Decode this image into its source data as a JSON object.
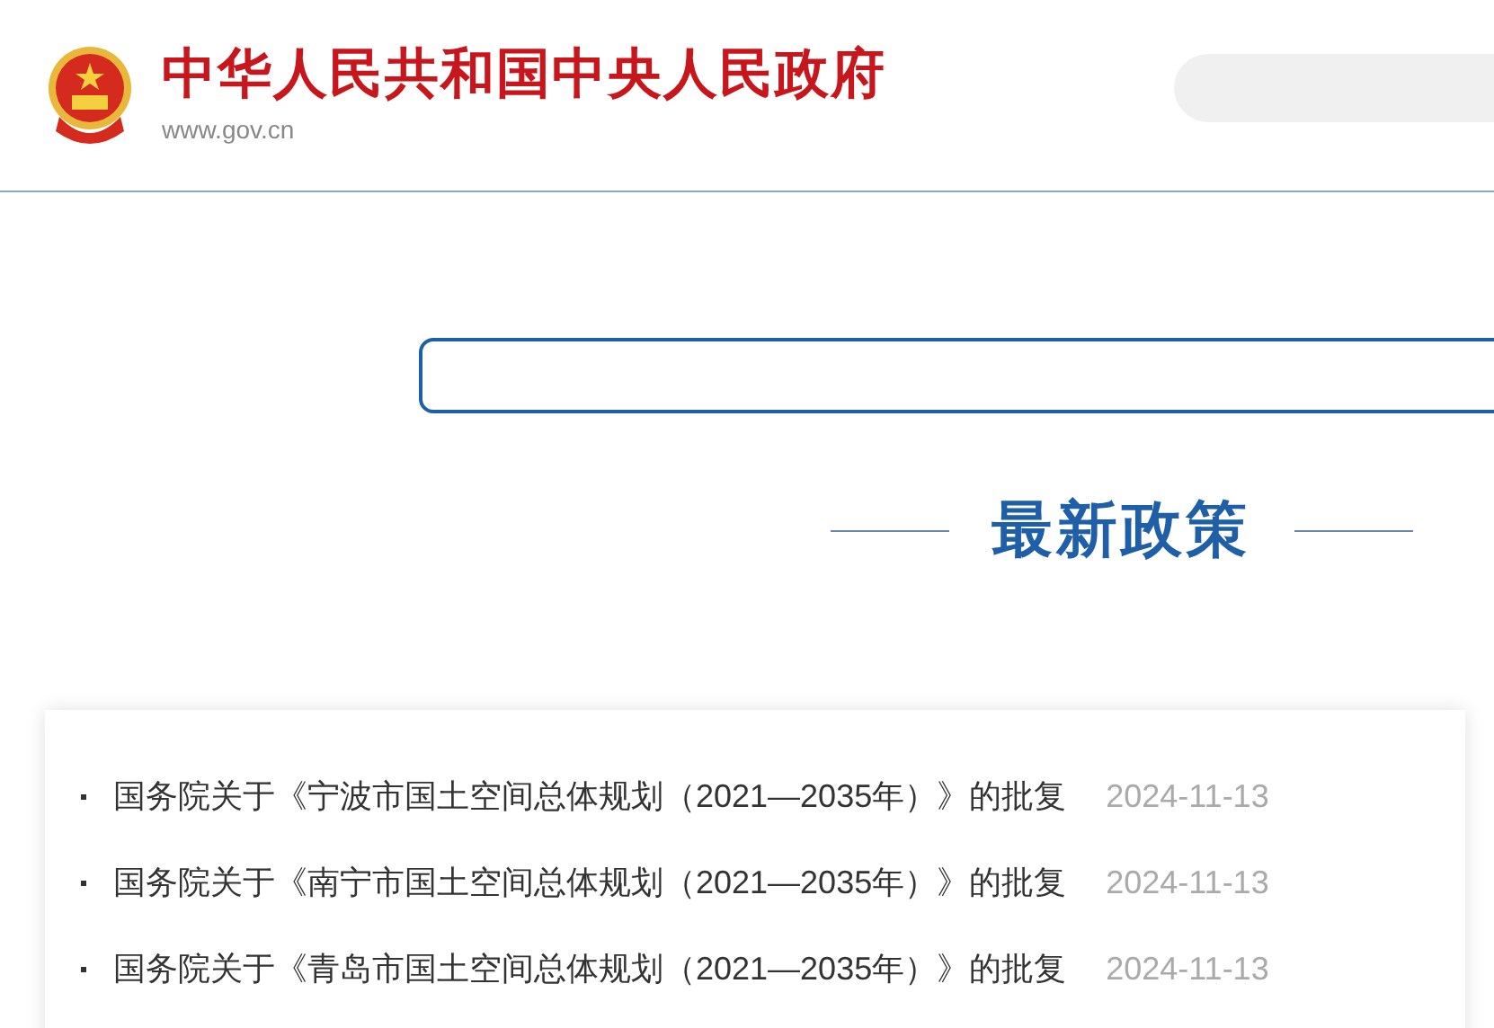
{
  "header": {
    "site_name": "中华人民共和国中央人民政府",
    "url": "www.gov.cn"
  },
  "section": {
    "title": "最新政策"
  },
  "policies": [
    {
      "title": "国务院关于《宁波市国土空间总体规划（2021—2035年）》的批复",
      "date": "2024-11-13"
    },
    {
      "title": "国务院关于《南宁市国土空间总体规划（2021—2035年）》的批复",
      "date": "2024-11-13"
    },
    {
      "title": "国务院关于《青岛市国土空间总体规划（2021—2035年）》的批复",
      "date": "2024-11-13"
    }
  ]
}
